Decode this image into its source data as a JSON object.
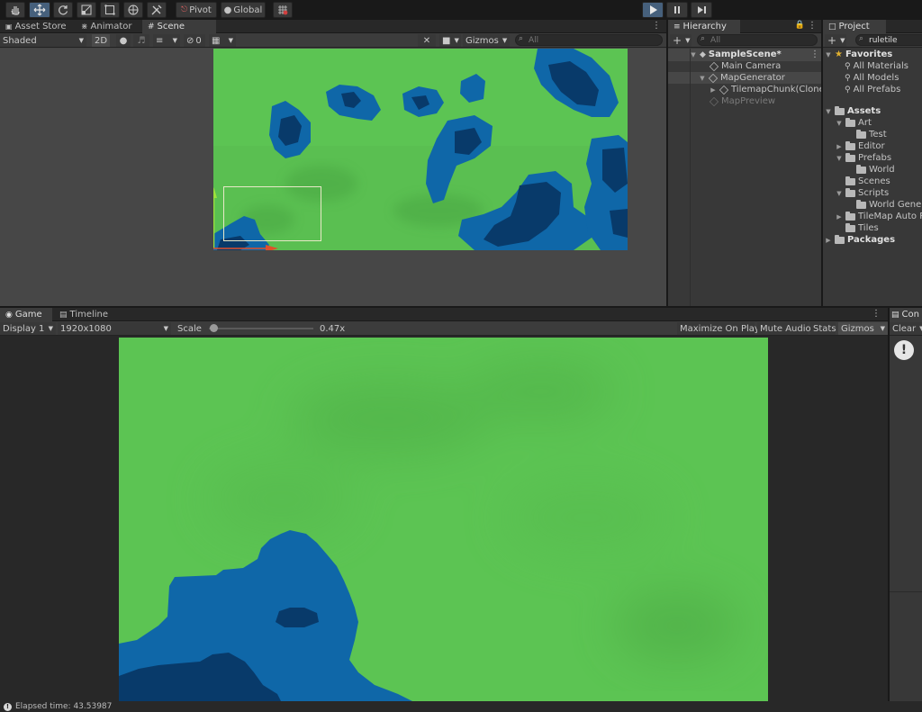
{
  "toolbar": {
    "pivot_label": "Pivot",
    "global_label": "Global"
  },
  "scene_panel": {
    "tabs": [
      "Asset Store",
      "Animator",
      "Scene"
    ],
    "shading_mode": "Shaded",
    "mode_2d_label": "2D",
    "hidden_count": "0",
    "gizmos_label": "Gizmos",
    "search_placeholder": "All"
  },
  "hierarchy": {
    "tab_label": "Hierarchy",
    "search_placeholder": "All",
    "scene_name": "SampleScene*",
    "items": [
      "Main Camera",
      "MapGenerator",
      "TilemapChunk(Clone)",
      "MapPreview"
    ]
  },
  "project": {
    "tab_label": "Project",
    "search_value": "ruletile",
    "favorites_label": "Favorites",
    "favorites": [
      "All Materials",
      "All Models",
      "All Prefabs"
    ],
    "assets_label": "Assets",
    "tree": [
      "Art",
      "Test",
      "Editor",
      "Prefabs",
      "World",
      "Scenes",
      "Scripts",
      "World Genera",
      "TileMap Auto Ru",
      "Tiles"
    ],
    "packages_label": "Packages"
  },
  "game_panel": {
    "tabs": [
      "Game",
      "Timeline"
    ],
    "display": "Display 1",
    "resolution": "1920x1080",
    "scale_label": "Scale",
    "scale_value": "0.47x",
    "scale_fraction": 0.047,
    "maximize_label": "Maximize On Play",
    "mute_label": "Mute Audio",
    "stats_label": "Stats",
    "gizmos_label": "Gizmos"
  },
  "console": {
    "tab_label": "Con",
    "clear_label": "Clear"
  },
  "status": {
    "text": "Elapsed time: 43.53987"
  },
  "colors": {
    "grass": "#5cc453",
    "water": "#0f67a8",
    "deep_water": "#083a6a",
    "play_active": "#46607c",
    "gizmo_y": "#9be03c",
    "gizmo_x": "#e0502b"
  }
}
